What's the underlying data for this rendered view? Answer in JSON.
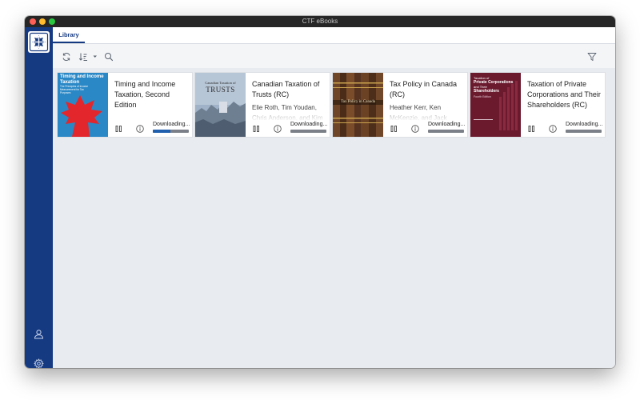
{
  "window": {
    "title": "CTF eBooks"
  },
  "sidebar": {
    "logo": "ctf-logo",
    "bottom_icons": [
      "user-icon",
      "gear-icon"
    ]
  },
  "tabs": [
    {
      "label": "Library",
      "active": true
    }
  ],
  "toolbar": {
    "icons": [
      "refresh-icon",
      "sort-icon",
      "sort-dropdown-caret-icon",
      "search-icon",
      "filter-icon"
    ]
  },
  "books": [
    {
      "title": "Timing and Income Taxation, Second Edition",
      "authors": "",
      "status": "Downloading...",
      "progress": 0.48,
      "cover": {
        "title": "Timing and Income Taxation",
        "subtitle": "The Principles of Income Measurement for Tax Purposes",
        "bg": "#2a88c6",
        "accent": "#e3262b"
      }
    },
    {
      "title": "Canadian Taxation of Trusts (RC)",
      "authors": "Elie Roth, Tim Youdan, Chris Anderson, and Kim",
      "status": "Downloading...",
      "progress": 0.0,
      "cover": {
        "title_top": "Canadian Taxation of",
        "title_big": "TRUSTS",
        "bg": "#9fb2c7"
      }
    },
    {
      "title": "Tax Policy in Canada (RC)",
      "authors": "Heather Kerr, Ken McKenzie, and Jack Mintz",
      "status": "Downloading...",
      "progress": 0.0,
      "cover": {
        "title": "Tax Policy in Canada",
        "bg": "#5a3a22"
      }
    },
    {
      "title": "Taxation of Private Corporations and Their Shareholders (RC)",
      "authors": "",
      "status": "Downloading...",
      "progress": 0.0,
      "cover": {
        "title_small": "Taxation of",
        "title_line1": "Private Corporations",
        "title_line2": "and Their",
        "title_line3": "Shareholders",
        "edition": "Fourth Edition",
        "bg": "#6b1a2e"
      }
    }
  ]
}
